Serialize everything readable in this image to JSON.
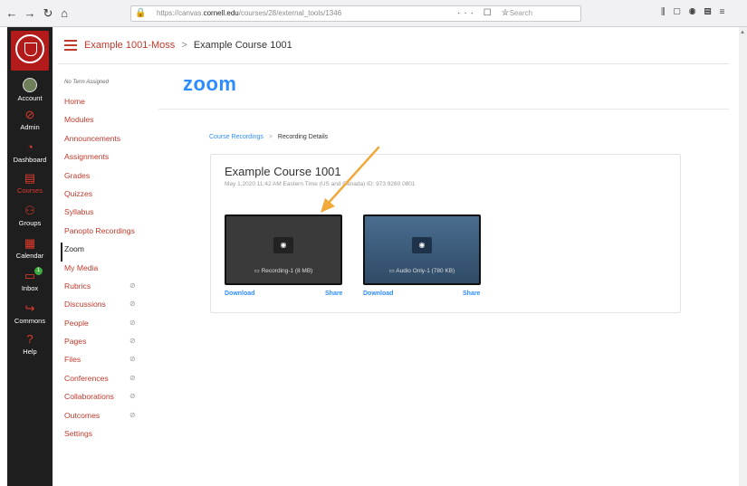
{
  "browser": {
    "url_base": "https://canvas.",
    "url_host": "cornell.edu",
    "url_path": "/courses/28/external_tools/1346",
    "search_placeholder": "Search",
    "page_actions": "··· ☐ ☆"
  },
  "global_nav": {
    "items": [
      {
        "label": "Account",
        "icon": "avatar"
      },
      {
        "label": "Admin",
        "icon": "admin-icon"
      },
      {
        "label": "Dashboard",
        "icon": "dashboard-icon"
      },
      {
        "label": "Courses",
        "icon": "courses-icon"
      },
      {
        "label": "Groups",
        "icon": "groups-icon"
      },
      {
        "label": "Calendar",
        "icon": "calendar-icon"
      },
      {
        "label": "Inbox",
        "icon": "inbox-icon",
        "badge": "1"
      },
      {
        "label": "Commons",
        "icon": "commons-icon"
      },
      {
        "label": "Help",
        "icon": "help-icon"
      }
    ]
  },
  "header": {
    "course_link": "Example 1001-Moss",
    "separator": ">",
    "current": "Example Course 1001"
  },
  "course_nav": {
    "term": "No Term Assigned",
    "items": [
      {
        "label": "Home"
      },
      {
        "label": "Modules"
      },
      {
        "label": "Announcements"
      },
      {
        "label": "Assignments"
      },
      {
        "label": "Grades"
      },
      {
        "label": "Quizzes"
      },
      {
        "label": "Syllabus"
      },
      {
        "label": "Panopto Recordings"
      },
      {
        "label": "Zoom",
        "active": true
      },
      {
        "label": "My Media"
      },
      {
        "label": "Rubrics",
        "hidden": true
      },
      {
        "label": "Discussions",
        "hidden": true
      },
      {
        "label": "People",
        "hidden": true
      },
      {
        "label": "Pages",
        "hidden": true
      },
      {
        "label": "Files",
        "hidden": true
      },
      {
        "label": "Conferences",
        "hidden": true
      },
      {
        "label": "Collaborations",
        "hidden": true
      },
      {
        "label": "Outcomes",
        "hidden": true
      },
      {
        "label": "Settings"
      }
    ]
  },
  "zoom": {
    "logo": "zoom",
    "breadcrumb_link": "Course Recordings",
    "breadcrumb_sep": ">",
    "breadcrumb_current": "Recording Details",
    "meeting_title": "Example Course 1001",
    "meeting_meta": "May 1,2020 11:42 AM Eastern Time (US and Canada)  ID: 973 9260 0801",
    "recordings": [
      {
        "caption": "Recording-1 (8 MB)",
        "download": "Download",
        "share": "Share"
      },
      {
        "caption": "Audio Only-1 (780 KB)",
        "download": "Download",
        "share": "Share"
      }
    ]
  },
  "colors": {
    "canvas_red": "#c0392b",
    "zoom_blue": "#2d8cff",
    "global_nav_bg": "#1e1e1e",
    "annotation_arrow": "#f0a93a"
  }
}
